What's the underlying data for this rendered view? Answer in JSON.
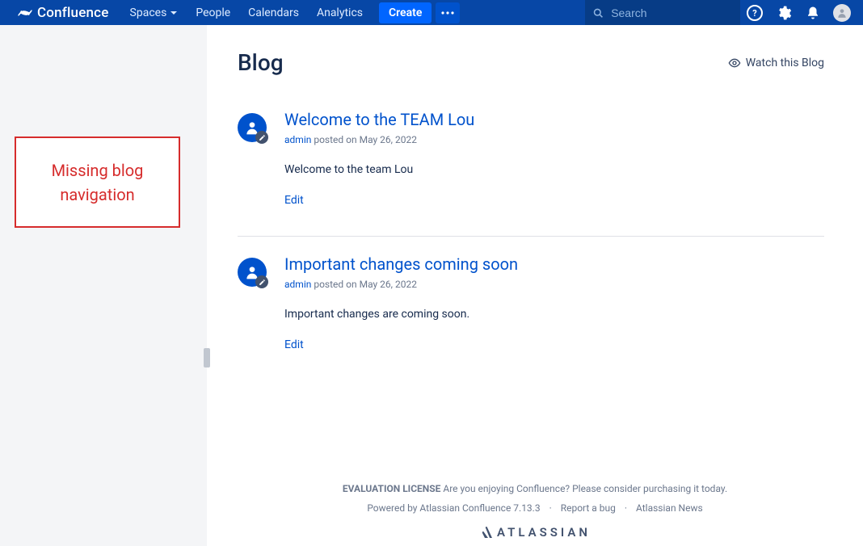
{
  "brand": "Confluence",
  "nav": {
    "spaces": "Spaces",
    "people": "People",
    "calendars": "Calendars",
    "analytics": "Analytics",
    "create": "Create"
  },
  "search": {
    "placeholder": "Search"
  },
  "sidebar_note": "Missing blog navigation",
  "page": {
    "title": "Blog",
    "watch": "Watch this Blog"
  },
  "posts": [
    {
      "title": "Welcome to the TEAM Lou",
      "author": "admin",
      "posted_prefix": " posted on ",
      "date": "May 26, 2022",
      "excerpt": "Welcome to the team Lou",
      "edit": "Edit"
    },
    {
      "title": "Important changes coming soon",
      "author": "admin",
      "posted_prefix": " posted on ",
      "date": "May 26, 2022",
      "excerpt": "Important changes are coming soon.",
      "edit": "Edit"
    }
  ],
  "footer": {
    "eval_bold": "EVALUATION LICENSE",
    "eval_rest": " Are you enjoying Confluence? Please consider purchasing it today.",
    "powered": "Powered by Atlassian Confluence 7.13.3",
    "report": "Report a bug",
    "news": "Atlassian News",
    "atlassian": "ATLASSIAN"
  }
}
